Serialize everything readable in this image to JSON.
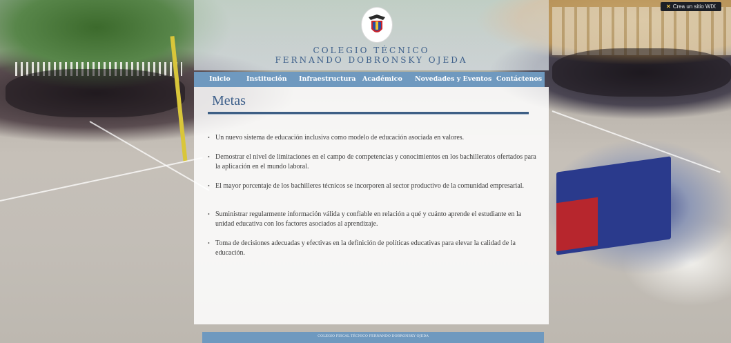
{
  "wix_badge": "Crea un sitio WIX",
  "site": {
    "title_line1": "COLEGIO TÉCNICO",
    "title_line2": "FERNANDO DOBRONSKY OJEDA"
  },
  "nav": [
    {
      "label": "Inicio"
    },
    {
      "label": "Institución"
    },
    {
      "label": "Infraestructura"
    },
    {
      "label": "Académico"
    },
    {
      "label": "Novedades y Eventos"
    },
    {
      "label": "Contáctenos"
    }
  ],
  "page": {
    "title": "Metas",
    "items": [
      "Un nuevo sistema de educación inclusiva como modelo de educación asociada en valores.",
      "Demostrar el nivel de limitaciones en el campo de competencias y conocimientos en los bachilleratos ofertados  para la aplicación en el  mundo laboral.",
      "El mayor porcentaje de los  bachilleres técnicos se incorporen al sector productivo de la comunidad empresarial.",
      "Suministrar regularmente información válida y confiable en relación a qué y cuánto aprende el estudiante en la unidad educativa con los factores asociados al aprendizaje.",
      "Toma de decisiones adecuadas y efectivas en la definición de políticas educativas para elevar la calidad de la educación."
    ]
  },
  "footer": {
    "line1": "COLEGIO FISCAL TÉCNICO FERNANDO DOBRONSKY OJEDA"
  },
  "colors": {
    "nav_bg": "#6f99bf",
    "title_text": "#3d5f8a",
    "rule": "#3e5f85"
  },
  "icons": [
    "school-crest-icon",
    "wix-x-icon"
  ]
}
